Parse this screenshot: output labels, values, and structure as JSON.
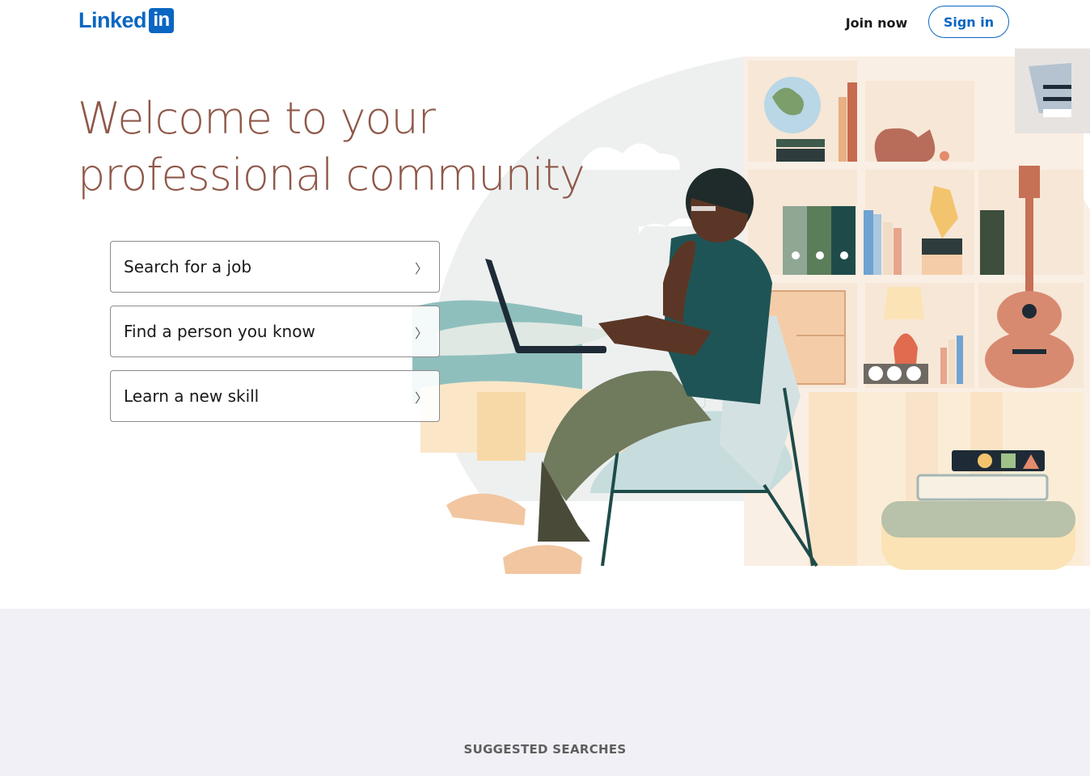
{
  "header": {
    "logo_text": "Linked",
    "logo_box": "in",
    "join_now": "Join now",
    "sign_in": "Sign in"
  },
  "hero": {
    "title_line1": "Welcome to your",
    "title_line2": "professional community"
  },
  "options": [
    {
      "label": "Search for a job",
      "icon": "chevron-right-icon"
    },
    {
      "label": "Find a person you know",
      "icon": "chevron-right-icon"
    },
    {
      "label": "Learn a new skill",
      "icon": "chevron-right-icon"
    }
  ],
  "lower": {
    "suggested_label": "SUGGESTED SEARCHES"
  },
  "colors": {
    "brand": "#0a66c2",
    "title": "#8f5849",
    "band": "#f1f0f7"
  }
}
